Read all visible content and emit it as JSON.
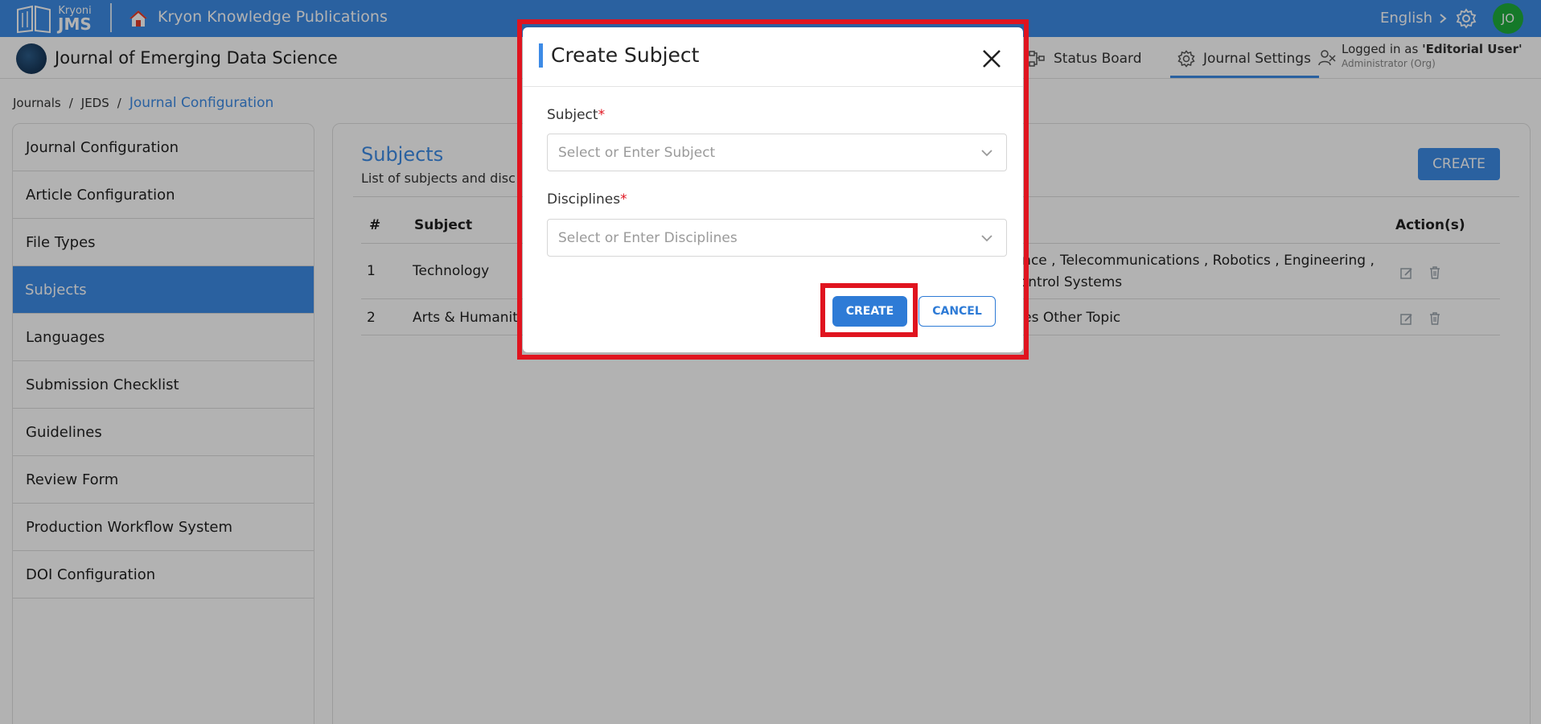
{
  "topbar": {
    "logo_small": "Kryoni",
    "logo_big": "JMS",
    "org_name": "Kryon Knowledge Publications",
    "language": "English",
    "avatar_initials": "JO"
  },
  "subbar": {
    "journal_name": "Journal of Emerging Data Science",
    "nav_status": "Status Board",
    "nav_settings": "Journal Settings",
    "login_prefix": "Logged in as ",
    "login_user": "'Editorial User'",
    "login_role": "Administrator (Org)"
  },
  "breadcrumb": {
    "items": [
      "Journals",
      "JEDS",
      "Journal Configuration"
    ]
  },
  "sidebar": {
    "items": [
      {
        "label": "Journal Configuration"
      },
      {
        "label": "Article Configuration"
      },
      {
        "label": "File Types"
      },
      {
        "label": "Subjects"
      },
      {
        "label": "Languages"
      },
      {
        "label": "Submission Checklist"
      },
      {
        "label": "Guidelines"
      },
      {
        "label": "Review Form"
      },
      {
        "label": "Production Workflow System"
      },
      {
        "label": "DOI Configuration"
      }
    ],
    "active_index": 3
  },
  "main": {
    "title": "Subjects",
    "subtitle": "List of subjects and disc",
    "create_label": "CREATE",
    "columns": [
      "#",
      "Subject",
      "Action(s)"
    ],
    "rows": [
      {
        "num": "1",
        "subject": "Technology",
        "disciplines_line1": "ience , Telecommunications , Robotics , Engineering ,",
        "disciplines_line2": "Control Systems"
      },
      {
        "num": "2",
        "subject": "Arts & Humaniti",
        "disciplines_line1": "ities Other Topic",
        "disciplines_line2": ""
      }
    ]
  },
  "modal": {
    "title": "Create Subject",
    "subject_label": "Subject",
    "subject_placeholder": "Select or Enter Subject",
    "disciplines_label": "Disciplines",
    "disciplines_placeholder": "Select or Enter Disciplines",
    "required_mark": "*",
    "create_label": "CREATE",
    "cancel_label": "CANCEL"
  },
  "colors": {
    "primary": "#3d8be6",
    "highlight": "#e0141f",
    "avatar": "#1fae3c"
  }
}
